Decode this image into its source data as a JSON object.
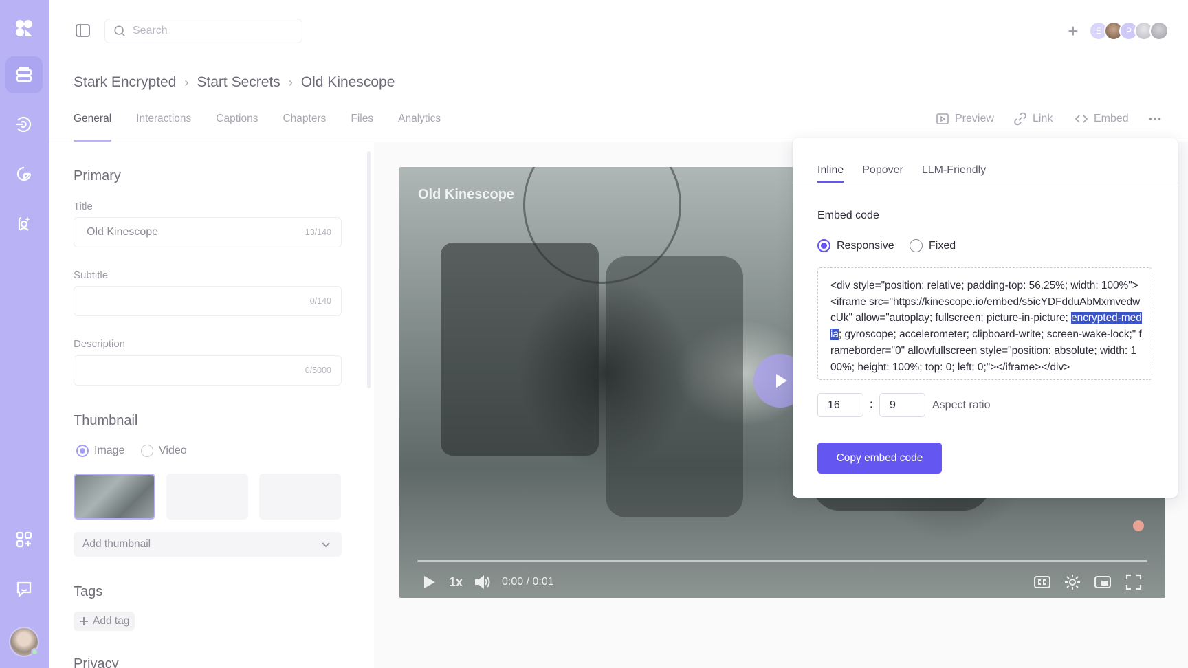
{
  "topbar": {
    "search_placeholder": "Search",
    "avatars": [
      "E",
      "",
      "P",
      "",
      ""
    ]
  },
  "breadcrumb": [
    "Stark Encrypted",
    "Start Secrets",
    "Old Kinescope"
  ],
  "tabs": [
    "General",
    "Interactions",
    "Captions",
    "Chapters",
    "Files",
    "Analytics"
  ],
  "actions": {
    "preview": "Preview",
    "link": "Link",
    "embed": "Embed"
  },
  "form": {
    "primary_title": "Primary",
    "title_label": "Title",
    "title_value": "Old Kinescope",
    "title_count": "13/140",
    "subtitle_label": "Subtitle",
    "subtitle_count": "0/140",
    "description_label": "Description",
    "description_count": "0/5000",
    "thumbnail_title": "Thumbnail",
    "thumb_option_image": "Image",
    "thumb_option_video": "Video",
    "add_thumbnail": "Add thumbnail",
    "tags_title": "Tags",
    "add_tag": "Add tag",
    "privacy_title": "Privacy"
  },
  "player": {
    "title": "Old Kinescope",
    "speed": "1x",
    "time": "0:00 / 0:01"
  },
  "embed": {
    "tabs": [
      "Inline",
      "Popover",
      "LLM-Friendly"
    ],
    "heading": "Embed code",
    "mode_responsive": "Responsive",
    "mode_fixed": "Fixed",
    "code_before": "<div style=\"position: relative; padding-top: 56.25%; width: 100%\"><iframe src=\"https://kinescope.io/embed/s5icYDFdduAbMxmvedwcUk\" allow=\"autoplay; fullscreen; picture-in-picture; ",
    "code_highlight": "encrypted-media",
    "code_after": "; gyroscope; accelerometer; clipboard-write; screen-wake-lock;\" frameborder=\"0\" allowfullscreen style=\"position: absolute; width: 100%; height: 100%; top: 0; left: 0;\"></iframe></div>",
    "ratio_w": "16",
    "ratio_sep": ":",
    "ratio_h": "9",
    "ratio_label": "Aspect ratio",
    "copy_button": "Copy embed code"
  },
  "colors": {
    "accent": "#6456f0",
    "rail": "#b9b3f6"
  }
}
